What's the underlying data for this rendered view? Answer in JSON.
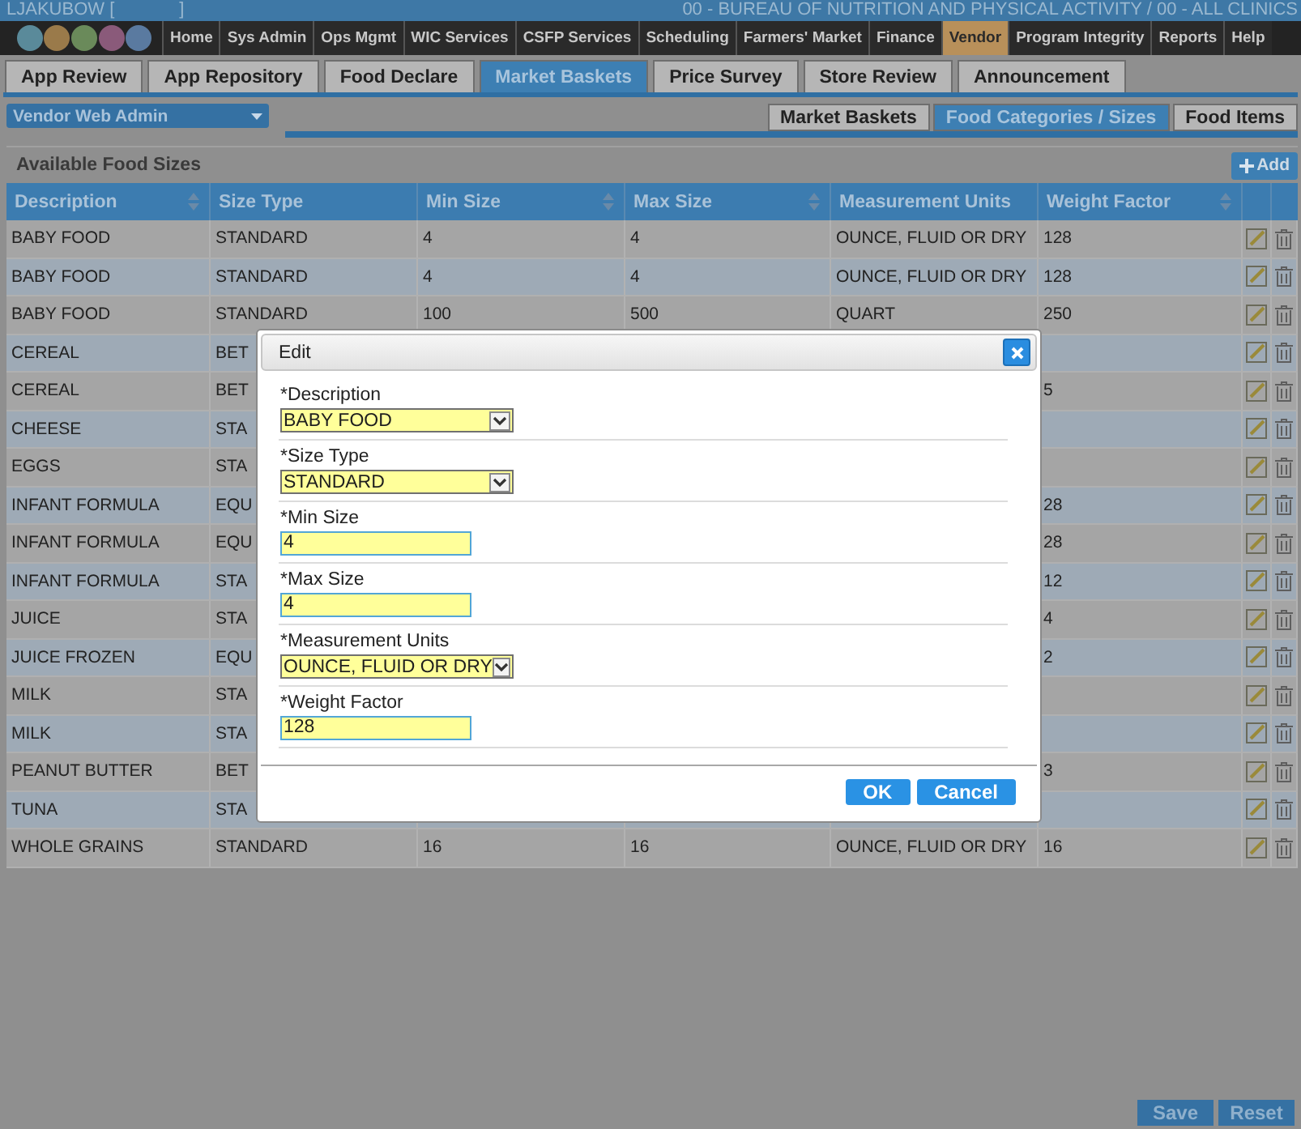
{
  "top_bar": {
    "user": "LJAKUBOW [",
    "user_end": "]",
    "agency": "00 - BUREAU OF NUTRITION AND PHYSICAL ACTIVITY / 00 - ALL CLINICS"
  },
  "nav": [
    {
      "label": "Home",
      "selected": false
    },
    {
      "label": "Sys Admin",
      "selected": false
    },
    {
      "label": "Ops Mgmt",
      "selected": false
    },
    {
      "label": "WIC Services",
      "selected": false
    },
    {
      "label": "CSFP Services",
      "selected": false
    },
    {
      "label": "Scheduling",
      "selected": false
    },
    {
      "label": "Farmers' Market",
      "selected": false
    },
    {
      "label": "Finance",
      "selected": false
    },
    {
      "label": "Vendor",
      "selected": true
    },
    {
      "label": "Program Integrity",
      "selected": false
    },
    {
      "label": "Reports",
      "selected": false
    },
    {
      "label": "Help",
      "selected": false
    }
  ],
  "tabs": [
    {
      "label": "App Review",
      "selected": false
    },
    {
      "label": "App Repository",
      "selected": false
    },
    {
      "label": "Food Declare",
      "selected": false
    },
    {
      "label": "Market Baskets",
      "selected": true
    },
    {
      "label": "Price Survey",
      "selected": false
    },
    {
      "label": "Store Review",
      "selected": false
    },
    {
      "label": "Announcement",
      "selected": false
    }
  ],
  "section_select": {
    "value": "Vendor Web Admin"
  },
  "sub_tabs": [
    {
      "label": "Market Baskets",
      "selected": false
    },
    {
      "label": "Food Categories / Sizes",
      "selected": true
    },
    {
      "label": "Food Items",
      "selected": false
    }
  ],
  "panel": {
    "title": "Available Food Sizes",
    "add_button": "Add"
  },
  "table": {
    "columns": [
      {
        "label": "Description",
        "sortable": true
      },
      {
        "label": "Size Type",
        "sortable": false
      },
      {
        "label": "Min Size",
        "sortable": true
      },
      {
        "label": "Max Size",
        "sortable": true
      },
      {
        "label": "Measurement Units",
        "sortable": false
      },
      {
        "label": "Weight Factor",
        "sortable": true
      }
    ],
    "rows": [
      {
        "description": "BABY FOOD",
        "size_type": "STANDARD",
        "min_size": "4",
        "max_size": "4",
        "units": "OUNCE, FLUID OR DRY",
        "weight": "128"
      },
      {
        "description": "BABY FOOD",
        "size_type": "STANDARD",
        "min_size": "4",
        "max_size": "4",
        "units": "OUNCE, FLUID OR DRY",
        "weight": "128"
      },
      {
        "description": "BABY FOOD",
        "size_type": "STANDARD",
        "min_size": "100",
        "max_size": "500",
        "units": "QUART",
        "weight": "250"
      },
      {
        "description": "CEREAL",
        "size_type": "BET"
      },
      {
        "description": "CEREAL",
        "size_type": "BET",
        "weight": "5"
      },
      {
        "description": "CHEESE",
        "size_type": "STA"
      },
      {
        "description": "EGGS",
        "size_type": "STA"
      },
      {
        "description": "INFANT FORMULA",
        "size_type": "EQU",
        "weight": "28"
      },
      {
        "description": "INFANT FORMULA",
        "size_type": "EQU",
        "weight": "28"
      },
      {
        "description": "INFANT FORMULA",
        "size_type": "STA",
        "weight": "12"
      },
      {
        "description": "JUICE",
        "size_type": "STA",
        "weight": "4"
      },
      {
        "description": "JUICE FROZEN",
        "size_type": "EQU",
        "weight": "2"
      },
      {
        "description": "MILK",
        "size_type": "STA"
      },
      {
        "description": "MILK",
        "size_type": "STA"
      },
      {
        "description": "PEANUT BUTTER",
        "size_type": "BET",
        "weight": "3"
      },
      {
        "description": "TUNA",
        "size_type": "STA"
      },
      {
        "description": "WHOLE GRAINS",
        "size_type": "STANDARD",
        "min_size": "16",
        "max_size": "16",
        "units": "OUNCE, FLUID OR DRY",
        "weight": "16"
      }
    ]
  },
  "dialog": {
    "title": "Edit",
    "fields": [
      {
        "kind": "select",
        "label": "*Description",
        "value": "BABY FOOD"
      },
      {
        "kind": "select",
        "label": "*Size Type",
        "value": "STANDARD"
      },
      {
        "kind": "input",
        "label": "*Min Size",
        "value": "4"
      },
      {
        "kind": "input",
        "label": "*Max Size",
        "value": "4"
      },
      {
        "kind": "select",
        "label": "*Measurement Units",
        "value": "OUNCE, FLUID OR DRY"
      },
      {
        "kind": "input",
        "label": "*Weight Factor",
        "value": "128"
      }
    ],
    "buttons": [
      "OK",
      "Cancel"
    ]
  },
  "footer_buttons": [
    "Save",
    "Reset"
  ]
}
